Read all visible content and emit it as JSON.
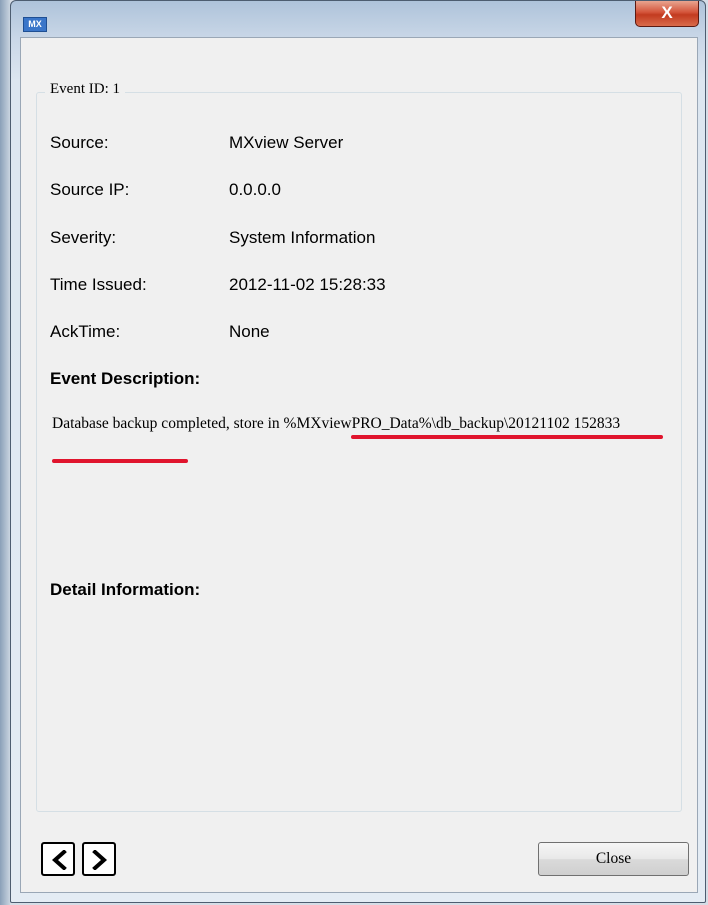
{
  "window": {
    "app_icon": "MX",
    "close_glyph": "X"
  },
  "group": {
    "legend": "Event ID: 1"
  },
  "fields": [
    {
      "label": "Source:",
      "value": "MXview Server"
    },
    {
      "label": "Source IP:",
      "value": "0.0.0.0"
    },
    {
      "label": "Severity:",
      "value": "System Information"
    },
    {
      "label": "Time Issued:",
      "value": "2012-11-02 15:28:33"
    },
    {
      "label": "AckTime:",
      "value": "None"
    }
  ],
  "description": {
    "title": "Event Description:",
    "text": "Database backup completed, store in %MXviewPRO_Data%\\db_backup\\20121102 152833",
    "highlight_color": "#e0142d"
  },
  "detail": {
    "title": "Detail Information:",
    "text": ""
  },
  "buttons": {
    "prev_icon": "chevron-left-icon",
    "next_icon": "chevron-right-icon",
    "close_label": "Close"
  }
}
